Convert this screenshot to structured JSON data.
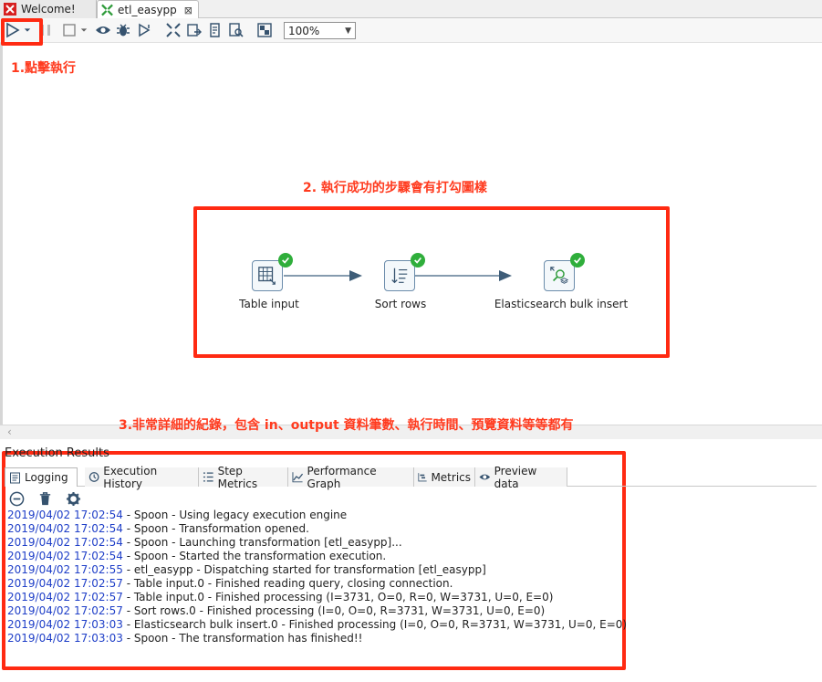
{
  "tabs": [
    {
      "label": "Welcome!"
    },
    {
      "label": "etl_easypp",
      "close": "⊠"
    }
  ],
  "toolbar": {
    "zoom_value": "100%"
  },
  "annotations": {
    "a1": "1.點擊執行",
    "a2": "2. 執行成功的步驟會有打勾圖樣",
    "a3": "3.非常詳細的紀錄，包含 in、output 資料筆數、執行時間、預覽資料等等都有"
  },
  "steps": [
    {
      "label": "Table input"
    },
    {
      "label": "Sort rows"
    },
    {
      "label": "Elasticsearch bulk insert"
    }
  ],
  "results": {
    "title": "Execution Results",
    "tabs": [
      {
        "label": "Logging"
      },
      {
        "label": "Execution History"
      },
      {
        "label": "Step Metrics"
      },
      {
        "label": "Performance Graph"
      },
      {
        "label": "Metrics"
      },
      {
        "label": "Preview data"
      }
    ],
    "log": [
      {
        "ts": "2019/04/02 17:02:54",
        "msg": " - Spoon - Using legacy execution engine"
      },
      {
        "ts": "2019/04/02 17:02:54",
        "msg": " - Spoon - Transformation opened."
      },
      {
        "ts": "2019/04/02 17:02:54",
        "msg": " - Spoon - Launching transformation [etl_easypp]..."
      },
      {
        "ts": "2019/04/02 17:02:54",
        "msg": " - Spoon - Started the transformation execution."
      },
      {
        "ts": "2019/04/02 17:02:55",
        "msg": " - etl_easypp - Dispatching started for transformation [etl_easypp]"
      },
      {
        "ts": "2019/04/02 17:02:57",
        "msg": " - Table input.0 - Finished reading query, closing connection."
      },
      {
        "ts": "2019/04/02 17:02:57",
        "msg": " - Table input.0 - Finished processing (I=3731, O=0, R=0, W=3731, U=0, E=0)"
      },
      {
        "ts": "2019/04/02 17:02:57",
        "msg": " - Sort rows.0 - Finished processing (I=0, O=0, R=3731, W=3731, U=0, E=0)"
      },
      {
        "ts": "2019/04/02 17:03:03",
        "msg": " - Elasticsearch bulk insert.0 - Finished processing (I=0, O=0, R=3731, W=3731, U=0, E=0)"
      },
      {
        "ts": "2019/04/02 17:03:03",
        "msg": " - Spoon - The transformation has finished!!"
      }
    ]
  },
  "colors": {
    "annotation": "#ff3b1f",
    "timestamp": "#1f3fc8",
    "success_check": "#2fae3b"
  }
}
